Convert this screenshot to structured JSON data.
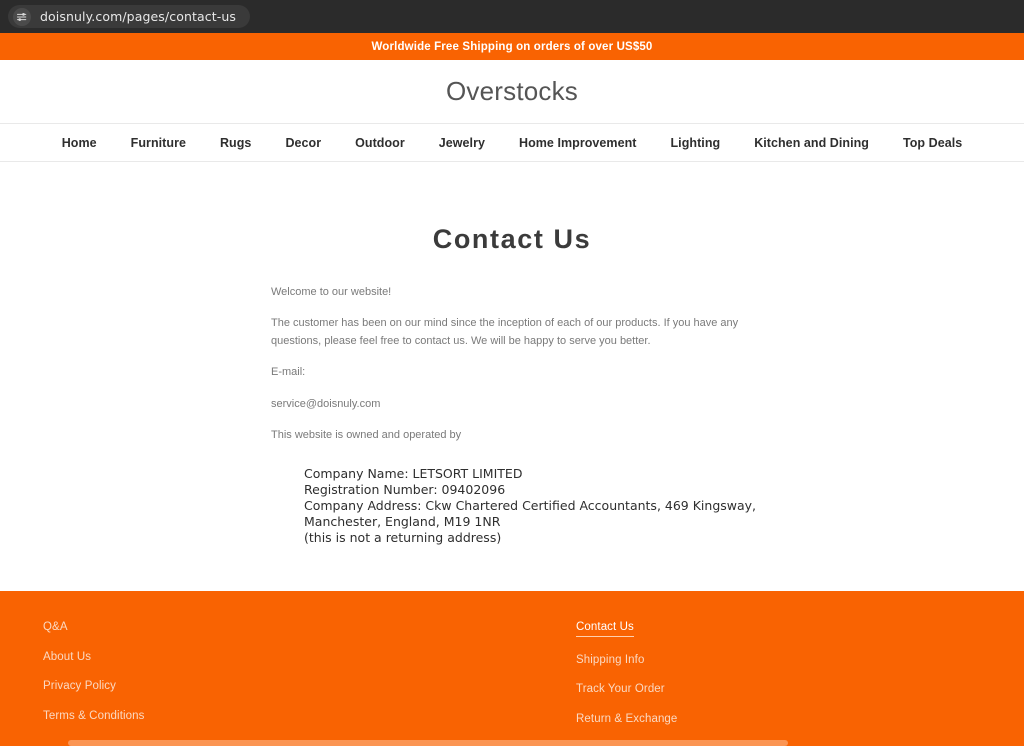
{
  "browser": {
    "url": "doisnuly.com/pages/contact-us",
    "site_settings_icon": "sliders-icon"
  },
  "announcement": {
    "text": "Worldwide Free Shipping on orders of over US$50"
  },
  "header": {
    "logo": "Overstocks"
  },
  "nav": {
    "items": [
      {
        "label": "Home"
      },
      {
        "label": "Furniture"
      },
      {
        "label": "Rugs"
      },
      {
        "label": "Decor"
      },
      {
        "label": "Outdoor"
      },
      {
        "label": "Jewelry"
      },
      {
        "label": "Home Improvement"
      },
      {
        "label": "Lighting"
      },
      {
        "label": "Kitchen and Dining"
      },
      {
        "label": "Top Deals"
      }
    ]
  },
  "page": {
    "title": "Contact Us",
    "welcome": "Welcome to our website!",
    "intro": "The customer has been on our mind since the inception of each of our products. If you have any questions, please feel free to contact us. We will be happy to serve you better.",
    "email_label": "E-mail:",
    "email": "service@doisnuly.com",
    "owned_by": "This website is owned and operated by",
    "company": {
      "name_line": "Company Name: LETSORT LIMITED",
      "registration_line": "Registration Number: 09402096",
      "address_line": "Company Address: Ckw Chartered Certified Accountants, 469 Kingsway, Manchester, England, M19 1NR",
      "note_line": "(this is not a returning address)"
    }
  },
  "footer": {
    "left_links": [
      {
        "label": "Q&A"
      },
      {
        "label": "About Us"
      },
      {
        "label": "Privacy Policy"
      },
      {
        "label": "Terms & Conditions"
      }
    ],
    "right_links": [
      {
        "label": "Contact Us",
        "active": true
      },
      {
        "label": "Shipping Info",
        "active": false
      },
      {
        "label": "Track Your Order",
        "active": false
      },
      {
        "label": "Return & Exchange",
        "active": false
      }
    ]
  },
  "colors": {
    "brand_orange": "#f96302",
    "chrome_dark": "#2b2b2b",
    "title_gray": "#3b3b3b",
    "body_gray": "#7a7a7a",
    "footer_link": "#fbd9c2"
  }
}
